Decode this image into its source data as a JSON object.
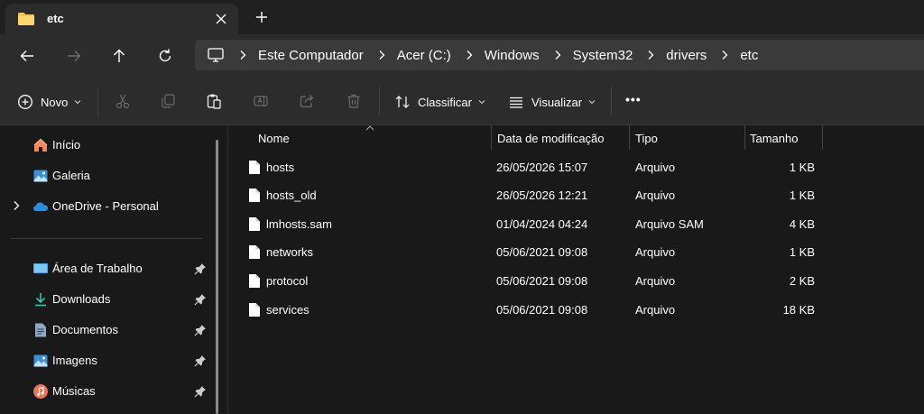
{
  "tab": {
    "title": "etc"
  },
  "breadcrumb": [
    "Este Computador",
    "Acer (C:)",
    "Windows",
    "System32",
    "drivers",
    "etc"
  ],
  "commandbar": {
    "new_label": "Novo",
    "sort_label": "Classificar",
    "view_label": "Visualizar",
    "more_label": "•••"
  },
  "sidebar": {
    "items": [
      {
        "label": "Início",
        "icon": "home-icon"
      },
      {
        "label": "Galeria",
        "icon": "gallery-icon"
      },
      {
        "label": "OneDrive - Personal",
        "icon": "onedrive-icon"
      },
      {
        "label": "Área de Trabalho",
        "icon": "desktop-icon"
      },
      {
        "label": "Downloads",
        "icon": "downloads-icon"
      },
      {
        "label": "Documentos",
        "icon": "documents-icon"
      },
      {
        "label": "Imagens",
        "icon": "pictures-icon"
      },
      {
        "label": "Músicas",
        "icon": "music-icon"
      }
    ]
  },
  "columns": {
    "name": "Nome",
    "date": "Data de modificação",
    "type": "Tipo",
    "size": "Tamanho"
  },
  "files": [
    {
      "name": "hosts",
      "date": "26/05/2026 15:07",
      "type": "Arquivo",
      "size": "1 KB"
    },
    {
      "name": "hosts_old",
      "date": "26/05/2026 12:21",
      "type": "Arquivo",
      "size": "1 KB"
    },
    {
      "name": "lmhosts.sam",
      "date": "01/04/2024 04:24",
      "type": "Arquivo SAM",
      "size": "4 KB"
    },
    {
      "name": "networks",
      "date": "05/06/2021 09:08",
      "type": "Arquivo",
      "size": "1 KB"
    },
    {
      "name": "protocol",
      "date": "05/06/2021 09:08",
      "type": "Arquivo",
      "size": "2 KB"
    },
    {
      "name": "services",
      "date": "05/06/2021 09:08",
      "type": "Arquivo",
      "size": "18 KB"
    }
  ],
  "colors": {
    "folder": "#f2c55c",
    "accent": "#4cc2ff",
    "background": "#191919",
    "chrome": "#2c2c2c"
  }
}
